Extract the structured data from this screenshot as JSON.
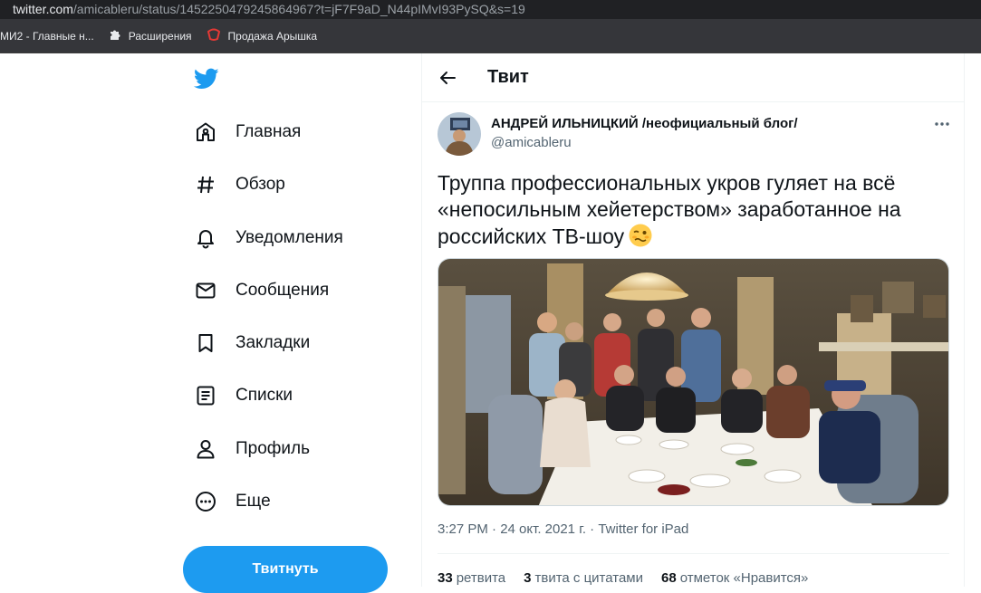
{
  "browser": {
    "url_host": "twitter.com",
    "url_path": "/amicableru/status/1452250479245864967?t=jF7F9aD_N44pIMvI93PySQ&s=19",
    "bookmarks": [
      {
        "label": "МИ2 - Главные н...",
        "icon": "page-icon"
      },
      {
        "label": "Расширения",
        "icon": "puzzle-icon"
      },
      {
        "label": "Продажа Арышка",
        "icon": "brand-icon"
      }
    ]
  },
  "nav": {
    "items": [
      {
        "label": "Главная",
        "icon": "home-icon"
      },
      {
        "label": "Обзор",
        "icon": "hashtag-icon"
      },
      {
        "label": "Уведомления",
        "icon": "bell-icon"
      },
      {
        "label": "Сообщения",
        "icon": "envelope-icon"
      },
      {
        "label": "Закладки",
        "icon": "bookmark-icon"
      },
      {
        "label": "Списки",
        "icon": "list-icon"
      },
      {
        "label": "Профиль",
        "icon": "person-icon"
      },
      {
        "label": "Еще",
        "icon": "more-circle-icon"
      }
    ],
    "tweet_button": "Твитнуть"
  },
  "header": {
    "title": "Твит"
  },
  "tweet": {
    "author_name": "АНДРЕЙ ИЛЬНИЦКИЙ /неофициальный блог/",
    "author_handle": "@amicableru",
    "text": "Труппа профессиональных укров гуляет на всё «непосильным хейетерством» заработанное на российских ТВ-шоу",
    "timestamp": "3:27 PM · 24 окт. 2021 г. · Twitter for iPad",
    "stats": [
      {
        "count": "33",
        "label": "ретвита"
      },
      {
        "count": "3",
        "label": "твита с цитатами"
      },
      {
        "count": "68",
        "label": "отметок «Нравится»"
      }
    ]
  },
  "colors": {
    "accent": "#1d9bf0",
    "text": "#0f1419",
    "muted": "#536471"
  }
}
